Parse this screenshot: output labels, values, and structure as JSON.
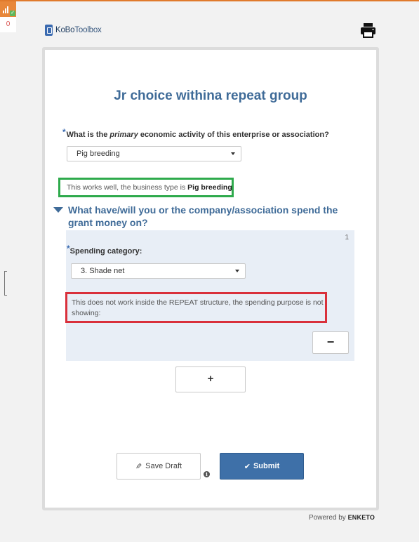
{
  "queue": {
    "count": "0"
  },
  "brand": {
    "logo_part1": "KoBo",
    "logo_part2": "Toolbox"
  },
  "form": {
    "title": "Jr choice withina repeat group",
    "question1": {
      "required_mark": "*",
      "label_pre": "What is the ",
      "label_em": "primary",
      "label_post": " economic activity of this enterprise or association?",
      "selected": "Pig breeding"
    },
    "note_green": {
      "text": "This works well, the business type is ",
      "value": "Pig breeding"
    },
    "group": {
      "label": "What have/will you or the company/association spend the grant money on?",
      "repeat_number": "1",
      "spending": {
        "required_mark": "*",
        "label": "Spending category:",
        "selected": "3. Shade net"
      },
      "note_red": "This does not work inside the REPEAT structure, the spending purpose is not showing:",
      "remove_label": "−"
    },
    "add_label": "+",
    "buttons": {
      "save_draft": "Save Draft",
      "submit": "Submit"
    }
  },
  "footer": {
    "powered_by": "Powered by",
    "brand": "ENKETO"
  },
  "colors": {
    "accent": "#3f6b98",
    "green_box": "#2eaa4c",
    "red_box": "#d9303b",
    "submit": "#3e70a8"
  }
}
